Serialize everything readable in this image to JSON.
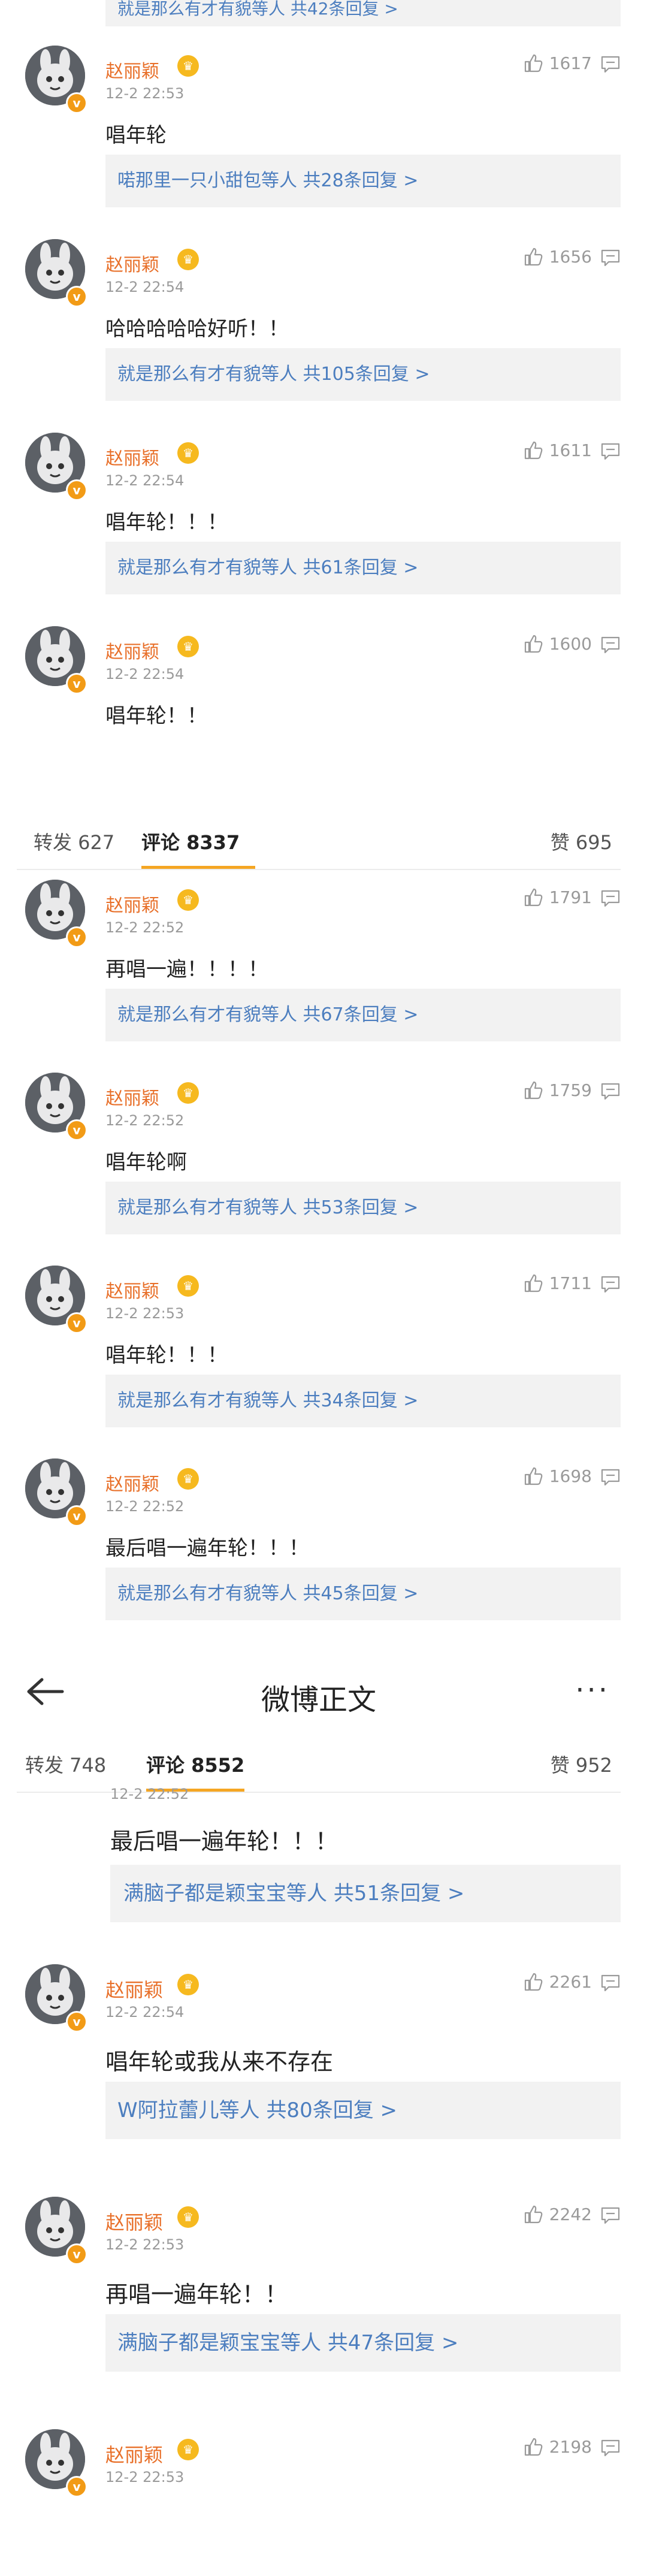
{
  "screen1": {
    "top_partial": "就是那么有才有貌等人 共42条回复 >",
    "comments": [
      {
        "name": "赵丽颖",
        "time": "12-2 22:53",
        "likes": "1617",
        "text": "唱年轮",
        "reply_by": "喏那里一只小甜包等人",
        "reply_count": "共28条回复 >"
      },
      {
        "name": "赵丽颖",
        "time": "12-2 22:54",
        "likes": "1656",
        "text": "哈哈哈哈哈好听！！",
        "reply_by": "就是那么有才有貌等人",
        "reply_count": "共105条回复 >"
      },
      {
        "name": "赵丽颖",
        "time": "12-2 22:54",
        "likes": "1611",
        "text": "唱年轮！！！",
        "reply_by": "就是那么有才有貌等人",
        "reply_count": "共61条回复 >"
      },
      {
        "name": "赵丽颖",
        "time": "12-2 22:54",
        "likes": "1600",
        "text": "唱年轮！！",
        "reply_by": "",
        "reply_count": ""
      }
    ]
  },
  "screen2": {
    "tabs": {
      "repost": "转发 627",
      "comments": "评论 8337",
      "likes": "赞 695"
    },
    "comments": [
      {
        "name": "赵丽颖",
        "time": "12-2 22:52",
        "likes": "1791",
        "text": "再唱一遍！！！！",
        "reply_by": "就是那么有才有貌等人",
        "reply_count": "共67条回复 >"
      },
      {
        "name": "赵丽颖",
        "time": "12-2 22:52",
        "likes": "1759",
        "text": "唱年轮啊",
        "reply_by": "就是那么有才有貌等人",
        "reply_count": "共53条回复 >"
      },
      {
        "name": "赵丽颖",
        "time": "12-2 22:53",
        "likes": "1711",
        "text": "唱年轮！！！",
        "reply_by": "就是那么有才有貌等人",
        "reply_count": "共34条回复 >"
      },
      {
        "name": "赵丽颖",
        "time": "12-2 22:52",
        "likes": "1698",
        "text": "最后唱一遍年轮！！！",
        "reply_by": "就是那么有才有貌等人",
        "reply_count": "共45条回复 >"
      }
    ]
  },
  "screen3": {
    "nav": {
      "title": "微博正文",
      "more": "···"
    },
    "tabs": {
      "repost": "转发 748",
      "comments": "评论 8552",
      "likes": "赞 952"
    },
    "partial": {
      "time": "12-2 22:52",
      "text": "最后唱一遍年轮！！！",
      "reply_by": "满脑子都是颖宝宝等人",
      "reply_count": "共51条回复 >"
    },
    "comments": [
      {
        "name": "赵丽颖",
        "time": "12-2 22:54",
        "likes": "2261",
        "text": "唱年轮或我从来不存在",
        "reply_by": "W阿拉蕾儿等人",
        "reply_count": "共80条回复 >"
      },
      {
        "name": "赵丽颖",
        "time": "12-2 22:53",
        "likes": "2242",
        "text": "再唱一遍年轮！！",
        "reply_by": "满脑子都是颖宝宝等人",
        "reply_count": "共47条回复 >"
      },
      {
        "name": "赵丽颖",
        "time": "12-2 22:53",
        "likes": "2198",
        "text": "",
        "reply_by": "",
        "reply_count": ""
      }
    ]
  },
  "colors": {
    "name": "#e8702a",
    "link": "#4c7ebf",
    "tab_underline": "#f5a623",
    "reply_bg": "#f2f2f2"
  },
  "icons": {
    "like": "thumb-up-icon",
    "reply": "comment-icon",
    "back": "back-arrow-icon",
    "badge": "verified-v-icon",
    "crown": "crown-icon"
  }
}
